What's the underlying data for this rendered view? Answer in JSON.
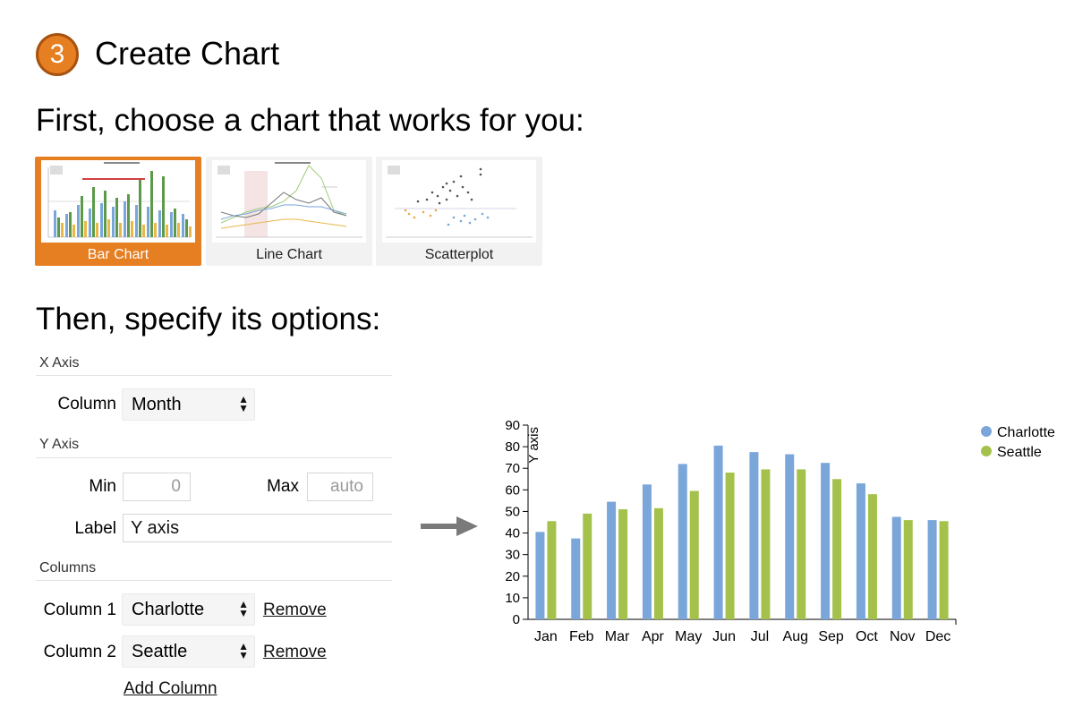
{
  "header": {
    "step_number": "3",
    "title": "Create Chart"
  },
  "intro": {
    "choose_text": "First, choose a chart that works for you:",
    "options_text": "Then, specify its options:"
  },
  "chart_types": [
    {
      "label": "Bar Chart",
      "selected": true
    },
    {
      "label": "Line Chart",
      "selected": false
    },
    {
      "label": "Scatterplot",
      "selected": false
    }
  ],
  "options": {
    "x_axis": {
      "section": "X Axis",
      "column_label": "Column",
      "column_value": "Month"
    },
    "y_axis": {
      "section": "Y Axis",
      "min_label": "Min",
      "min_placeholder": "0",
      "max_label": "Max",
      "max_placeholder": "auto",
      "label_label": "Label",
      "label_value": "Y axis"
    },
    "columns": {
      "section": "Columns",
      "items": [
        {
          "label": "Column 1",
          "value": "Charlotte",
          "remove": "Remove"
        },
        {
          "label": "Column 2",
          "value": "Seattle",
          "remove": "Remove"
        }
      ],
      "add": "Add Column"
    }
  },
  "colors": {
    "accent": "#e67e22",
    "charlotte": "#7aa6da",
    "seattle": "#a4c24b"
  },
  "icons": {
    "arrow": "arrow-right-icon",
    "select_arrows": "up-down-arrows-icon"
  },
  "chart_data": {
    "type": "bar",
    "categories": [
      "Jan",
      "Feb",
      "Mar",
      "Apr",
      "May",
      "Jun",
      "Jul",
      "Aug",
      "Sep",
      "Oct",
      "Nov",
      "Dec"
    ],
    "series": [
      {
        "name": "Charlotte",
        "values": [
          40.5,
          37.5,
          54.5,
          62.5,
          72,
          80.5,
          77.5,
          76.5,
          72.5,
          63,
          47.5,
          46
        ]
      },
      {
        "name": "Seattle",
        "values": [
          45.5,
          49,
          51,
          51.5,
          59.5,
          68,
          69.5,
          69.5,
          65,
          58,
          46,
          45.5
        ]
      }
    ],
    "ylabel": "Y axis",
    "ylim": [
      0,
      90
    ],
    "yticks": [
      "0",
      "10",
      "20",
      "30",
      "40",
      "50",
      "60",
      "70",
      "80",
      "90"
    ],
    "legend": "top-right",
    "grid": false
  }
}
